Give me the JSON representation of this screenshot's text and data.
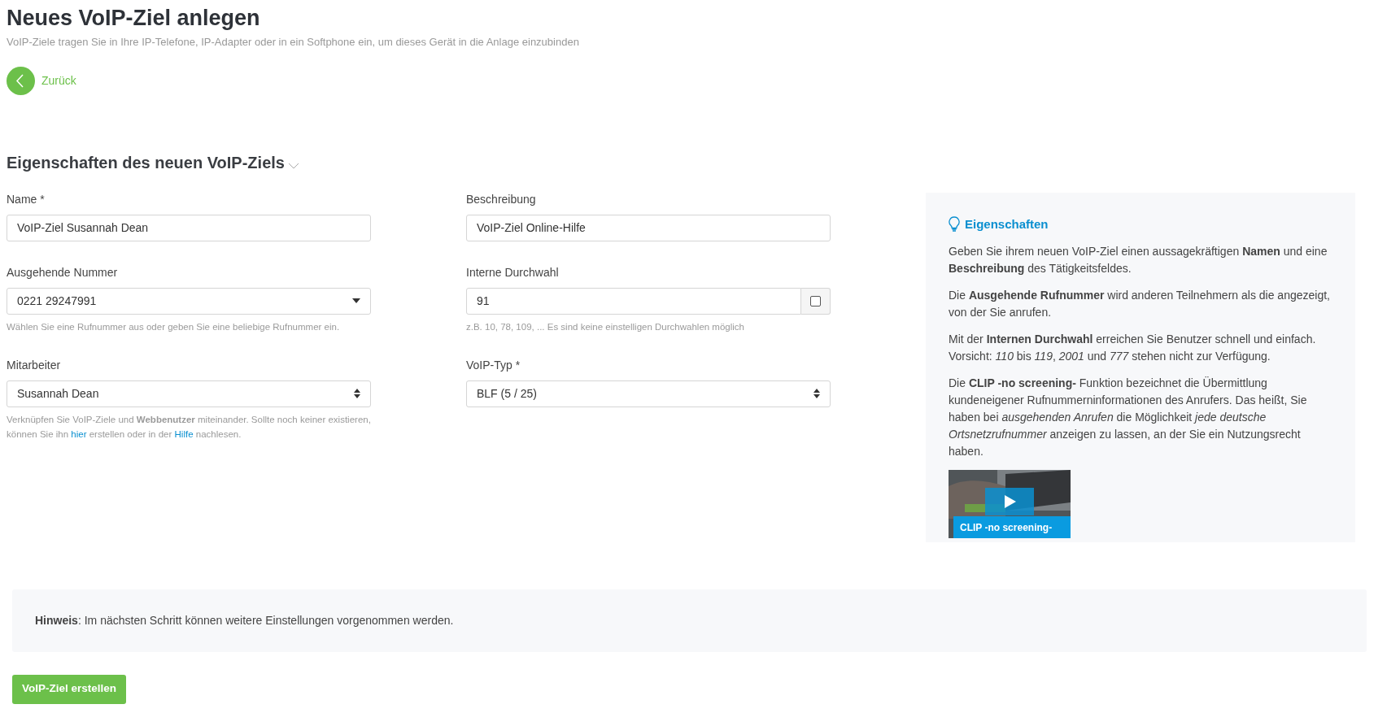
{
  "page": {
    "title": "Neues VoIP-Ziel anlegen",
    "subtitle": "VoIP-Ziele tragen Sie in Ihre IP-Telefone, IP-Adapter oder in ein Softphone ein, um dieses Gerät in die Anlage einzubinden"
  },
  "back_link": {
    "label": "Zurück"
  },
  "section": {
    "title": "Eigenschaften des neuen VoIP-Ziels",
    "expanded": true
  },
  "fields": [
    {
      "kind": "text",
      "label": "Name *",
      "value": "VoIP-Ziel Susannah Dean"
    },
    {
      "kind": "text",
      "label": "Beschreibung",
      "value": "VoIP-Ziel Online-Hilfe"
    },
    {
      "kind": "combo",
      "label": "Ausgehende Nummer",
      "value": "0221 29247991",
      "help": [
        {
          "kind": "text",
          "text": "Wählen Sie eine Rufnummer aus oder geben Sie eine beliebige Rufnummer ein."
        }
      ]
    },
    {
      "kind": "checkaddon",
      "label": "Interne Durchwahl",
      "value": "91",
      "checked": false,
      "help": [
        {
          "kind": "text",
          "text": "z.B. 10, 78, 109, ... Es sind keine einstelligen Durchwahlen möglich"
        }
      ]
    },
    {
      "kind": "select",
      "label": "Mitarbeiter",
      "value": "Susannah Dean",
      "help": [
        {
          "kind": "text",
          "text": "Verknüpfen Sie VoIP-Ziele und **Webbenutzer** miteinander. Sollte noch keiner existieren, können Sie ihn "
        },
        {
          "kind": "link",
          "text": "hier"
        },
        {
          "kind": "text",
          "text": " erstellen oder in der "
        },
        {
          "kind": "link",
          "text": "Hilfe"
        },
        {
          "kind": "text",
          "text": " nachlesen."
        }
      ]
    },
    {
      "kind": "select",
      "label": "VoIP-Typ *",
      "value": "BLF (5 / 25)"
    }
  ],
  "info_panel": {
    "title": "Eigenschaften",
    "paragraphs": [
      "Geben Sie ihrem neuen VoIP-Ziel einen aussagekräftigen **Namen** und eine **Beschreibung** des Tätigkeitsfeldes.",
      "Die **Ausgehende Rufnummer** wird anderen Teilnehmern als die angezeigt, von der Sie anrufen.",
      "Mit der **Internen Durchwahl** erreichen Sie Benutzer schnell und einfach. Vorsicht: *110* bis *119*, *2001* und *777* stehen nicht zur Verfügung.",
      "Die **CLIP -no screening-** Funktion bezeichnet die Übermittlung kundeneigener Rufnummerninformationen des Anrufers. Das heißt, Sie haben bei *ausgehenden Anrufen* die Möglichkeit *jede deutsche Ortsnetzrufnummer* anzeigen zu lassen, an der Sie ein Nutzungsrecht haben."
    ],
    "video": {
      "kind": "picture",
      "caption": "CLIP -no screening-"
    }
  },
  "notice": "**Hinweis**: Im nächsten Schritt können weitere Einstellungen vorgenommen werden.",
  "submit_button": {
    "label": "VoIP-Ziel erstellen"
  }
}
